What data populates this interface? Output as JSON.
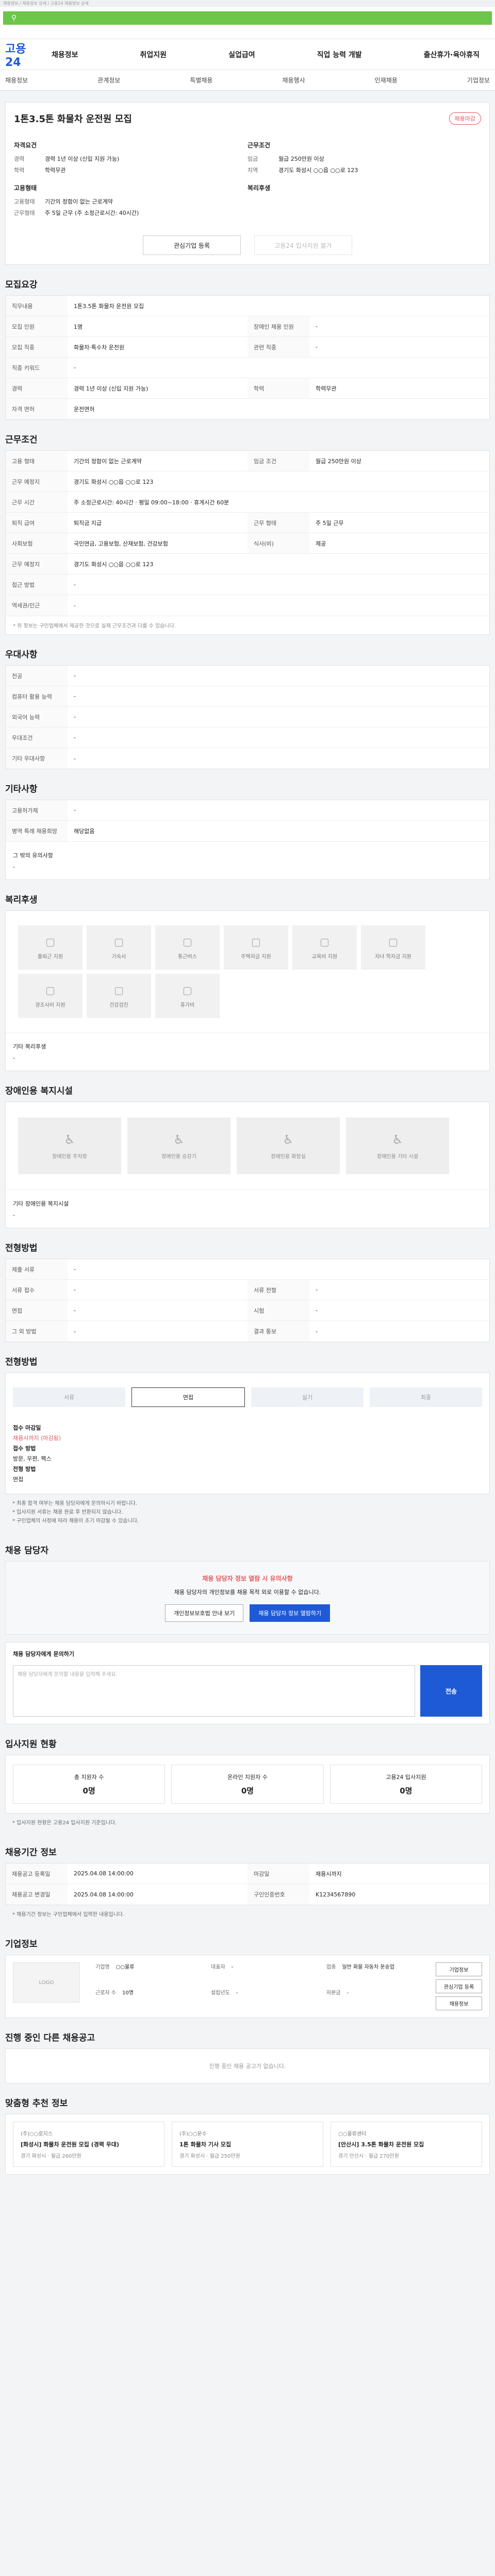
{
  "top_notice": "채용정보 / 채용정보 상세 / 고용24 채용정보 상세",
  "site": {
    "logo": "고용24"
  },
  "gnb": [
    "채용정보",
    "취업지원",
    "실업급여",
    "직업 능력 개발",
    "출산휴가·육아휴직"
  ],
  "subnav": [
    "채용정보",
    "관계정보",
    "특별채용",
    "채용행사",
    "인재채용",
    "기업정보"
  ],
  "job": {
    "title": "1톤3.5톤 화물차 운전원 모집",
    "badge": "채용마감",
    "col1_title": "자격요건",
    "col1": [
      {
        "k": "경력",
        "v": "경력 1년 이상 (신입 지원 가능)"
      },
      {
        "k": "학력",
        "v": "학력무관"
      }
    ],
    "col1b_title": "고용형태",
    "col1b": [
      {
        "k": "고용형태",
        "v": "기간의 정함이 없는 근로계약"
      },
      {
        "k": "근무형태",
        "v": "주 5일 근무 (주 소정근로시간: 40시간)"
      }
    ],
    "col2_title": "근무조건",
    "col2": [
      {
        "k": "임금",
        "v": "월급 250만원 이상"
      },
      {
        "k": "지역",
        "v": "경기도 화성시 ○○읍 ○○로 123"
      }
    ],
    "col2b_title": "복리후생",
    "col2b": [],
    "btn_interest": "관심기업 등록",
    "btn_apply": "고용24 입사지원 불가"
  },
  "recruit": {
    "title": "모집요강",
    "rows": [
      {
        "k": "직무내용",
        "v": "1톤3.5톤 화물차 운전원 모집"
      },
      {
        "k": "모집 인원",
        "v": "1명",
        "k2": "장애인 채용 인원",
        "v2": "-"
      },
      {
        "k": "모집 직종",
        "v": "화물차·특수차 운전원",
        "k2": "관련 직종",
        "v2": "-"
      },
      {
        "k": "직종 키워드",
        "v": "-"
      },
      {
        "k": "경력",
        "v": "경력 1년 이상 (신입 지원 가능)",
        "k2": "학력",
        "v2": "학력무관"
      },
      {
        "k": "자격 면허",
        "v": "운전면허"
      }
    ]
  },
  "conditions": {
    "title": "근무조건",
    "rows": [
      {
        "k": "고용 형태",
        "v": "기간의 정함이 없는 근로계약",
        "k2": "임금 조건",
        "v2": "월급 250만원 이상"
      },
      {
        "k": "근무 예정지",
        "v": "경기도 화성시 ○○읍 ○○로 123"
      },
      {
        "k": "근무 시간",
        "v": "주 소정근로시간: 40시간 · 평일 09:00~18:00 · 휴게시간 60분"
      },
      {
        "k": "퇴직 급여",
        "v": "퇴직금 지급",
        "k2": "근무 형태",
        "v2": "주 5일 근무"
      },
      {
        "k": "사회보험",
        "v": "국민연금, 고용보험, 산재보험, 건강보험",
        "k2": "식사(비)",
        "v2": "제공"
      },
      {
        "k": "근무 예정지",
        "v": "경기도 화성시 ○○읍 ○○로 123"
      },
      {
        "k": "접근 방법",
        "v": "-"
      },
      {
        "k": "역세권/인근",
        "v": "-"
      }
    ],
    "note": "* 위 정보는 구인업체에서 제공한 것으로 실제 근무조건과 다를 수 있습니다."
  },
  "prefer": {
    "title": "우대사항",
    "rows": [
      {
        "k": "전공",
        "v": "-"
      },
      {
        "k": "컴퓨터 활용 능력",
        "v": "-"
      },
      {
        "k": "외국어 능력",
        "v": "-"
      },
      {
        "k": "우대조건",
        "v": "-"
      },
      {
        "k": "기타 우대사항",
        "v": "-"
      }
    ]
  },
  "etc": {
    "title": "기타사항",
    "rows": [
      {
        "k": "고용허가제",
        "v": "-"
      },
      {
        "k": "병역 특례 채용희망",
        "v": "해당없음"
      }
    ],
    "sub_title": "그 밖의 유의사항",
    "sub_val": "-"
  },
  "welfare": {
    "title": "복리후생",
    "tiles": [
      "출퇴근 지원",
      "기숙사",
      "통근버스",
      "주택자금 지원",
      "교육비 지원",
      "자녀 학자금 지원",
      "경조사비 지원",
      "건강검진",
      "휴가비"
    ],
    "sub_title": "기타 복리후생",
    "sub_val": "-"
  },
  "disabled": {
    "title": "장애인용 복지시설",
    "tiles": [
      "장애인용 주차장",
      "장애인용 승강기",
      "장애인용 화장실",
      "장애인용 기타 시설"
    ],
    "sub_title": "기타 장애인용 복지시설",
    "sub_val": "-"
  },
  "apply": {
    "title": "전형방법",
    "rows": [
      {
        "k": "제출 서류",
        "v": "-"
      },
      {
        "k": "서류 접수",
        "v": "-",
        "k2": "서류 전형",
        "v2": "-"
      },
      {
        "k": "면접",
        "v": "-",
        "k2": "시험",
        "v2": "-"
      },
      {
        "k": "그 외 방법",
        "v": "-",
        "k2": "결과 통보",
        "v2": "-"
      }
    ]
  },
  "process": {
    "title": "전형방법",
    "steps": [
      "서류",
      "면접",
      "실기",
      "최종"
    ],
    "detail": [
      "접수 마감일",
      "채용시까지 (마감됨)",
      "접수 방법",
      "방문, 우편, 팩스",
      "전형 방법",
      "면접"
    ],
    "bullets": [
      "* 최종 합격 여부는 채용 담당자에게 문의하시기 바랍니다.",
      "* 입사지원 서류는 채용 완료 후 반환되지 않습니다.",
      "* 구인업체의 사정에 따라 채용이 조기 마감될 수 있습니다."
    ]
  },
  "contact": {
    "title": "채용 담당자",
    "warn_title": "채용 담당자 정보 열람 시 유의사항",
    "warn_text": "채용 담당자의 개인정보를 채용 목적 외로 이용할 수 없습니다.",
    "btn1": "개인정보보호법 안내 보기",
    "btn2": "채용 담당자 정보 열람하기",
    "inq_title": "채용 담당자에게 문의하기",
    "inq_placeholder": "채용 담당자에게 문의할 내용을 입력해 주세요.",
    "send": "전송"
  },
  "status": {
    "title": "입사지원 현황",
    "items": [
      {
        "label": "총 지원자 수",
        "n": "0명"
      },
      {
        "label": "온라인 지원자 수",
        "n": "0명"
      },
      {
        "label": "고용24 입사지원",
        "n": "0명"
      }
    ],
    "note": "* 입사지원 현황은 고용24 입사지원 기준입니다."
  },
  "period": {
    "title": "채용기간 정보",
    "rows": [
      {
        "k": "채용공고 등록일",
        "v": "2025.04.08 14:00:00",
        "k2": "마감일",
        "v2": "채용시까지"
      },
      {
        "k": "채용공고 변경일",
        "v": "2025.04.08 14:00:00",
        "k2": "구인인증번호",
        "v2": "K1234567890"
      }
    ],
    "note": "* 채용기간 정보는 구인업체에서 입력한 내용입니다."
  },
  "company": {
    "title": "기업정보",
    "logo": "LOGO",
    "rows": [
      [
        "기업명",
        "○○물류"
      ],
      [
        "대표자",
        "-"
      ],
      [
        "업종",
        "일반 화물 자동차 운송업"
      ],
      [
        "근로자 수",
        "10명"
      ],
      [
        "설립년도",
        "-"
      ],
      [
        "자본금",
        "-"
      ]
    ],
    "btn1": "기업정보",
    "btn2": "관심기업 등록",
    "btn3": "채용정보"
  },
  "more": {
    "title": "진행 중인 다른 채용공고",
    "empty": "진행 중인 채용 공고가 없습니다."
  },
  "recs": {
    "title": "맞춤형 추천 정보",
    "items": [
      {
        "co": "(주)○○로지스",
        "t": "[화성시] 화물차 운전원 모집 (경력 우대)",
        "m": "경기 화성시 · 월급 260만원"
      },
      {
        "co": "(주)○○운수",
        "t": "1톤 화물차 기사 모집",
        "m": "경기 화성시 · 월급 250만원"
      },
      {
        "co": "○○물류센터",
        "t": "[안산시] 3.5톤 화물차 운전원 모집",
        "m": "경기 안산시 · 월급 270만원"
      }
    ]
  }
}
